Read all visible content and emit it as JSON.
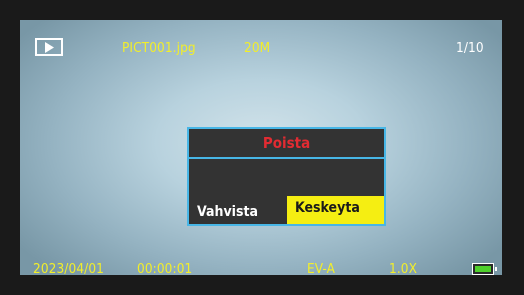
{
  "top_bar": {
    "mode_icon": "playback-icon",
    "filename": "PICT001.jpg",
    "resolution": "20M",
    "counter": "1/10"
  },
  "dialog": {
    "title": "Poista",
    "confirm_label": "Vahvista",
    "cancel_label": "Keskeyta",
    "selected": "Keskeyta"
  },
  "bottom_bar": {
    "date": "2023/04/01",
    "time": "00:00:01",
    "ev": "EV-A",
    "zoom": "1.0X",
    "battery_icon": "battery-full-icon",
    "battery_level": 1.0
  },
  "colors": {
    "status_text": "#f2ee2a",
    "dialog_border": "#47b6e6",
    "dialog_title": "#e22b32",
    "selection": "#f5ee12",
    "battery_fill": "#4fd02c"
  }
}
